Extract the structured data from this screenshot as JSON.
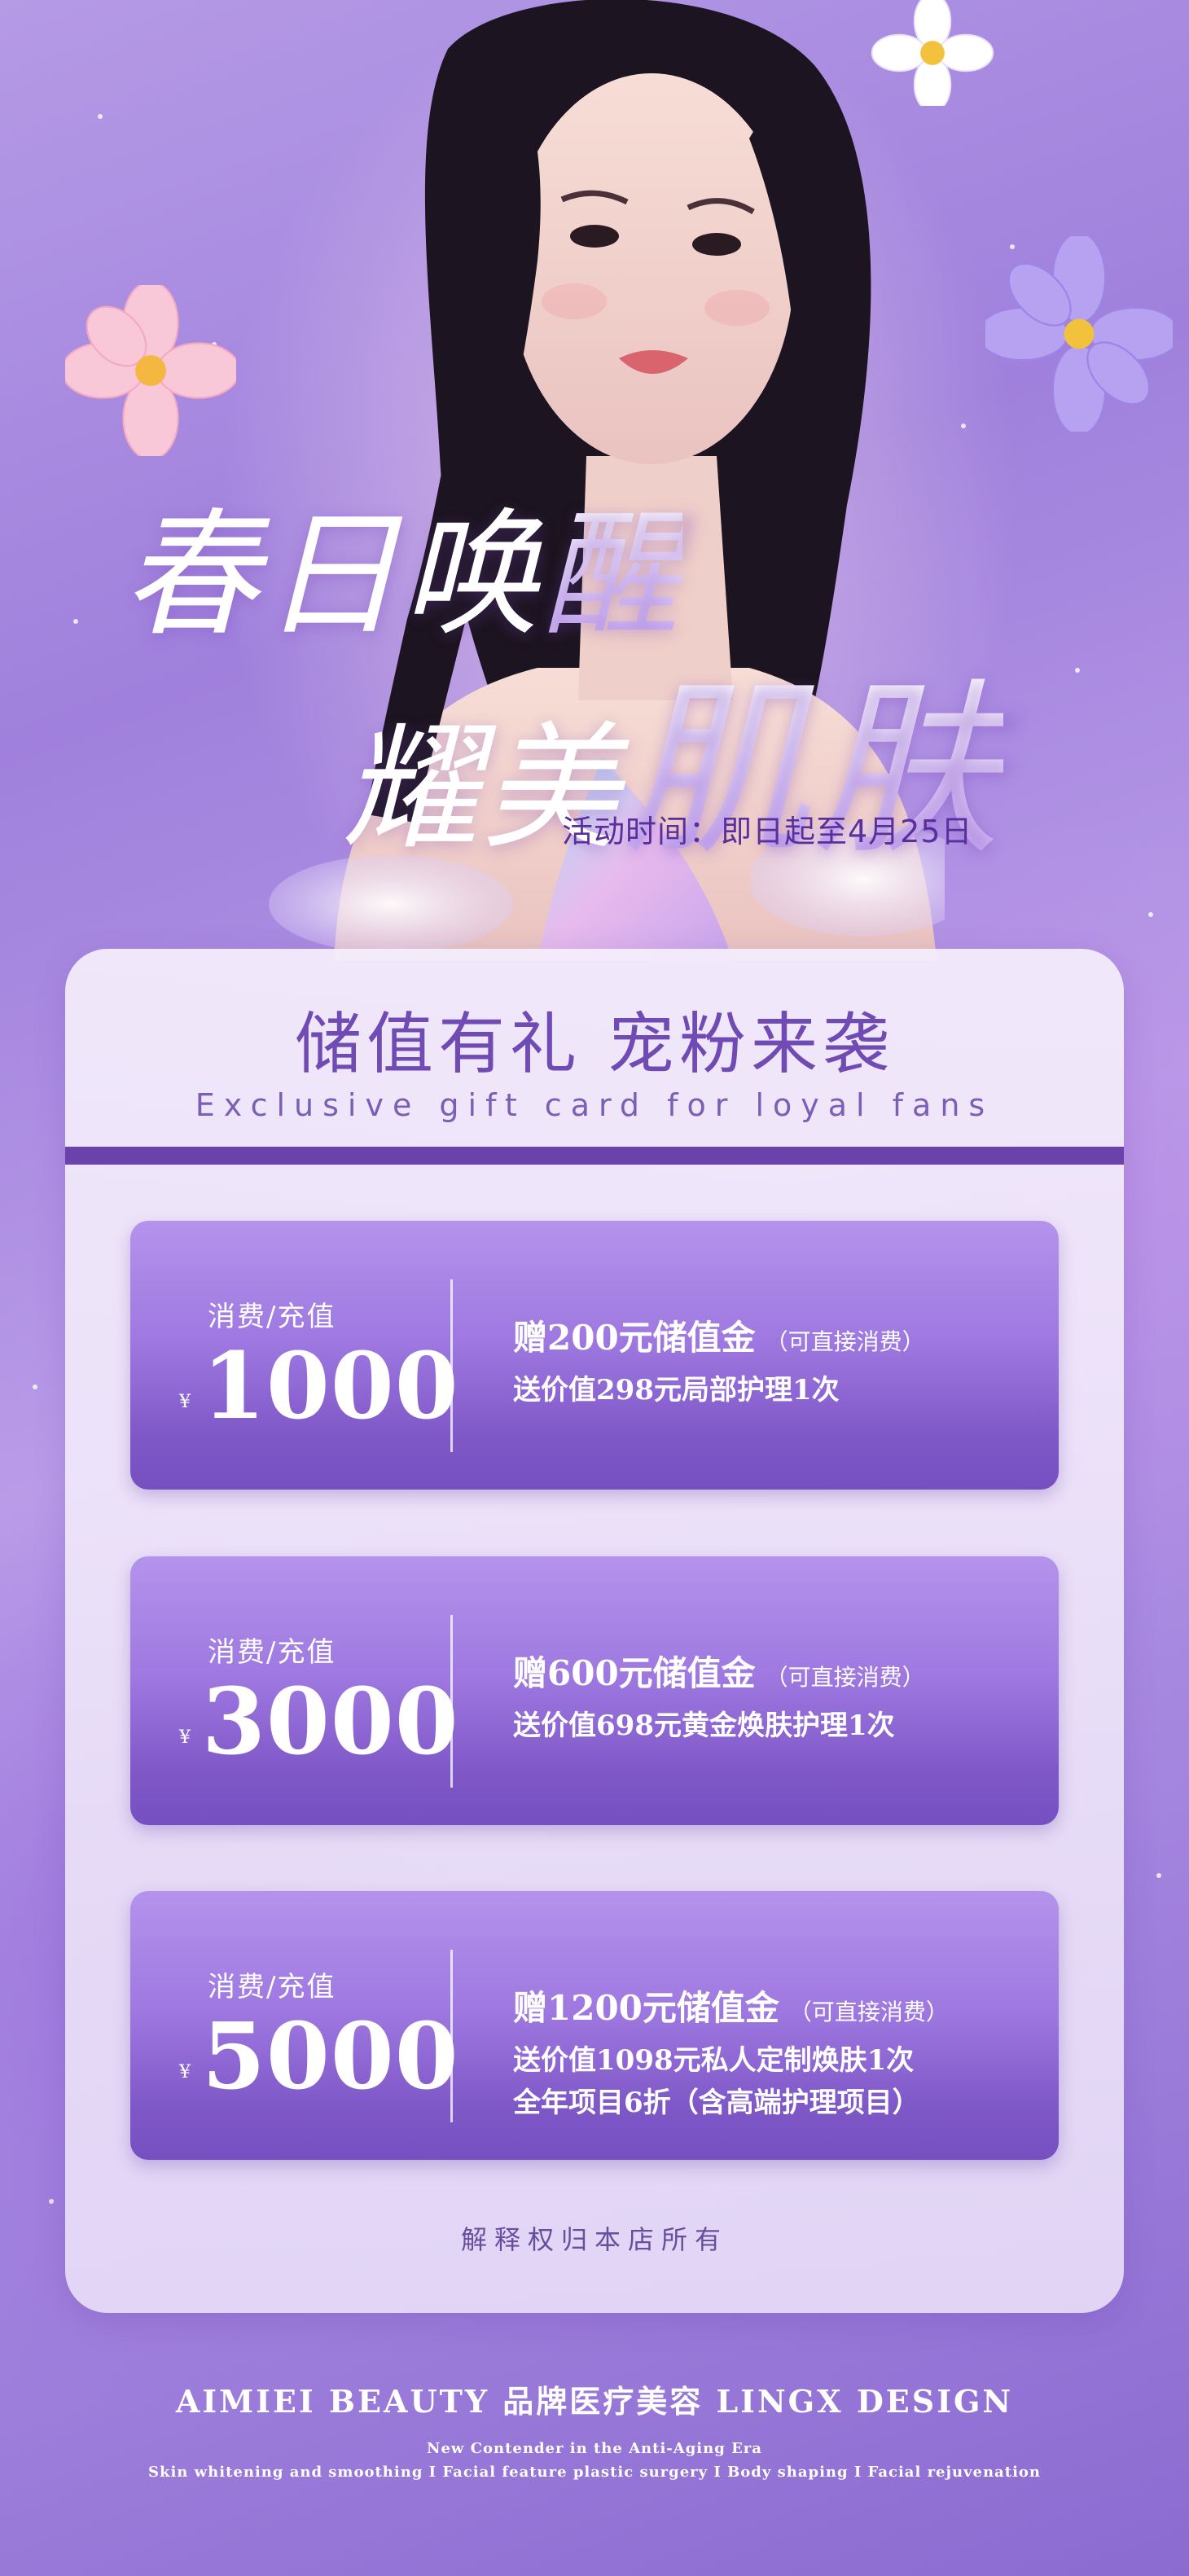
{
  "hero": {
    "line1_part1": "春日唤",
    "line1_part2": "醒",
    "line2_part1": "耀美",
    "line2_part2": "肌肤",
    "event_time": "活动时间：即日起至4月25日"
  },
  "card": {
    "title": "储值有礼  宠粉来袭",
    "subtitle": "Exclusive gift card for loyal fans",
    "tiers": [
      {
        "label": "消费/充值",
        "currency": "¥",
        "amount": "1000",
        "gift": "赠200元储值金",
        "gift_note": "（可直接消费）",
        "desc": [
          "送价值298元局部护理1次"
        ]
      },
      {
        "label": "消费/充值",
        "currency": "¥",
        "amount": "3000",
        "gift": "赠600元储值金",
        "gift_note": "（可直接消费）",
        "desc": [
          "送价值698元黄金焕肤护理1次"
        ]
      },
      {
        "label": "消费/充值",
        "currency": "¥",
        "amount": "5000",
        "gift": "赠1200元储值金",
        "gift_note": "（可直接消费）",
        "desc": [
          "送价值1098元私人定制焕肤1次",
          "全年项目6折（含高端护理项目）"
        ]
      }
    ],
    "disclaimer": "解释权归本店所有"
  },
  "footer": {
    "brand": "AIMIEI BEAUTY  品牌医疗美容  LINGX DESIGN",
    "tagline": "New Contender in the Anti-Aging Era",
    "services": "Skin whitening and smoothing I Facial feature plastic surgery I Body shaping I Facial rejuvenation"
  },
  "colors": {
    "accent": "#6b42ac",
    "tier_top": "#b493ec",
    "tier_bottom": "#7650c0",
    "event_text": "#5a2f9c"
  },
  "icons": [
    "pink-flower-icon",
    "white-daisy-icon",
    "purple-flower-icon"
  ]
}
